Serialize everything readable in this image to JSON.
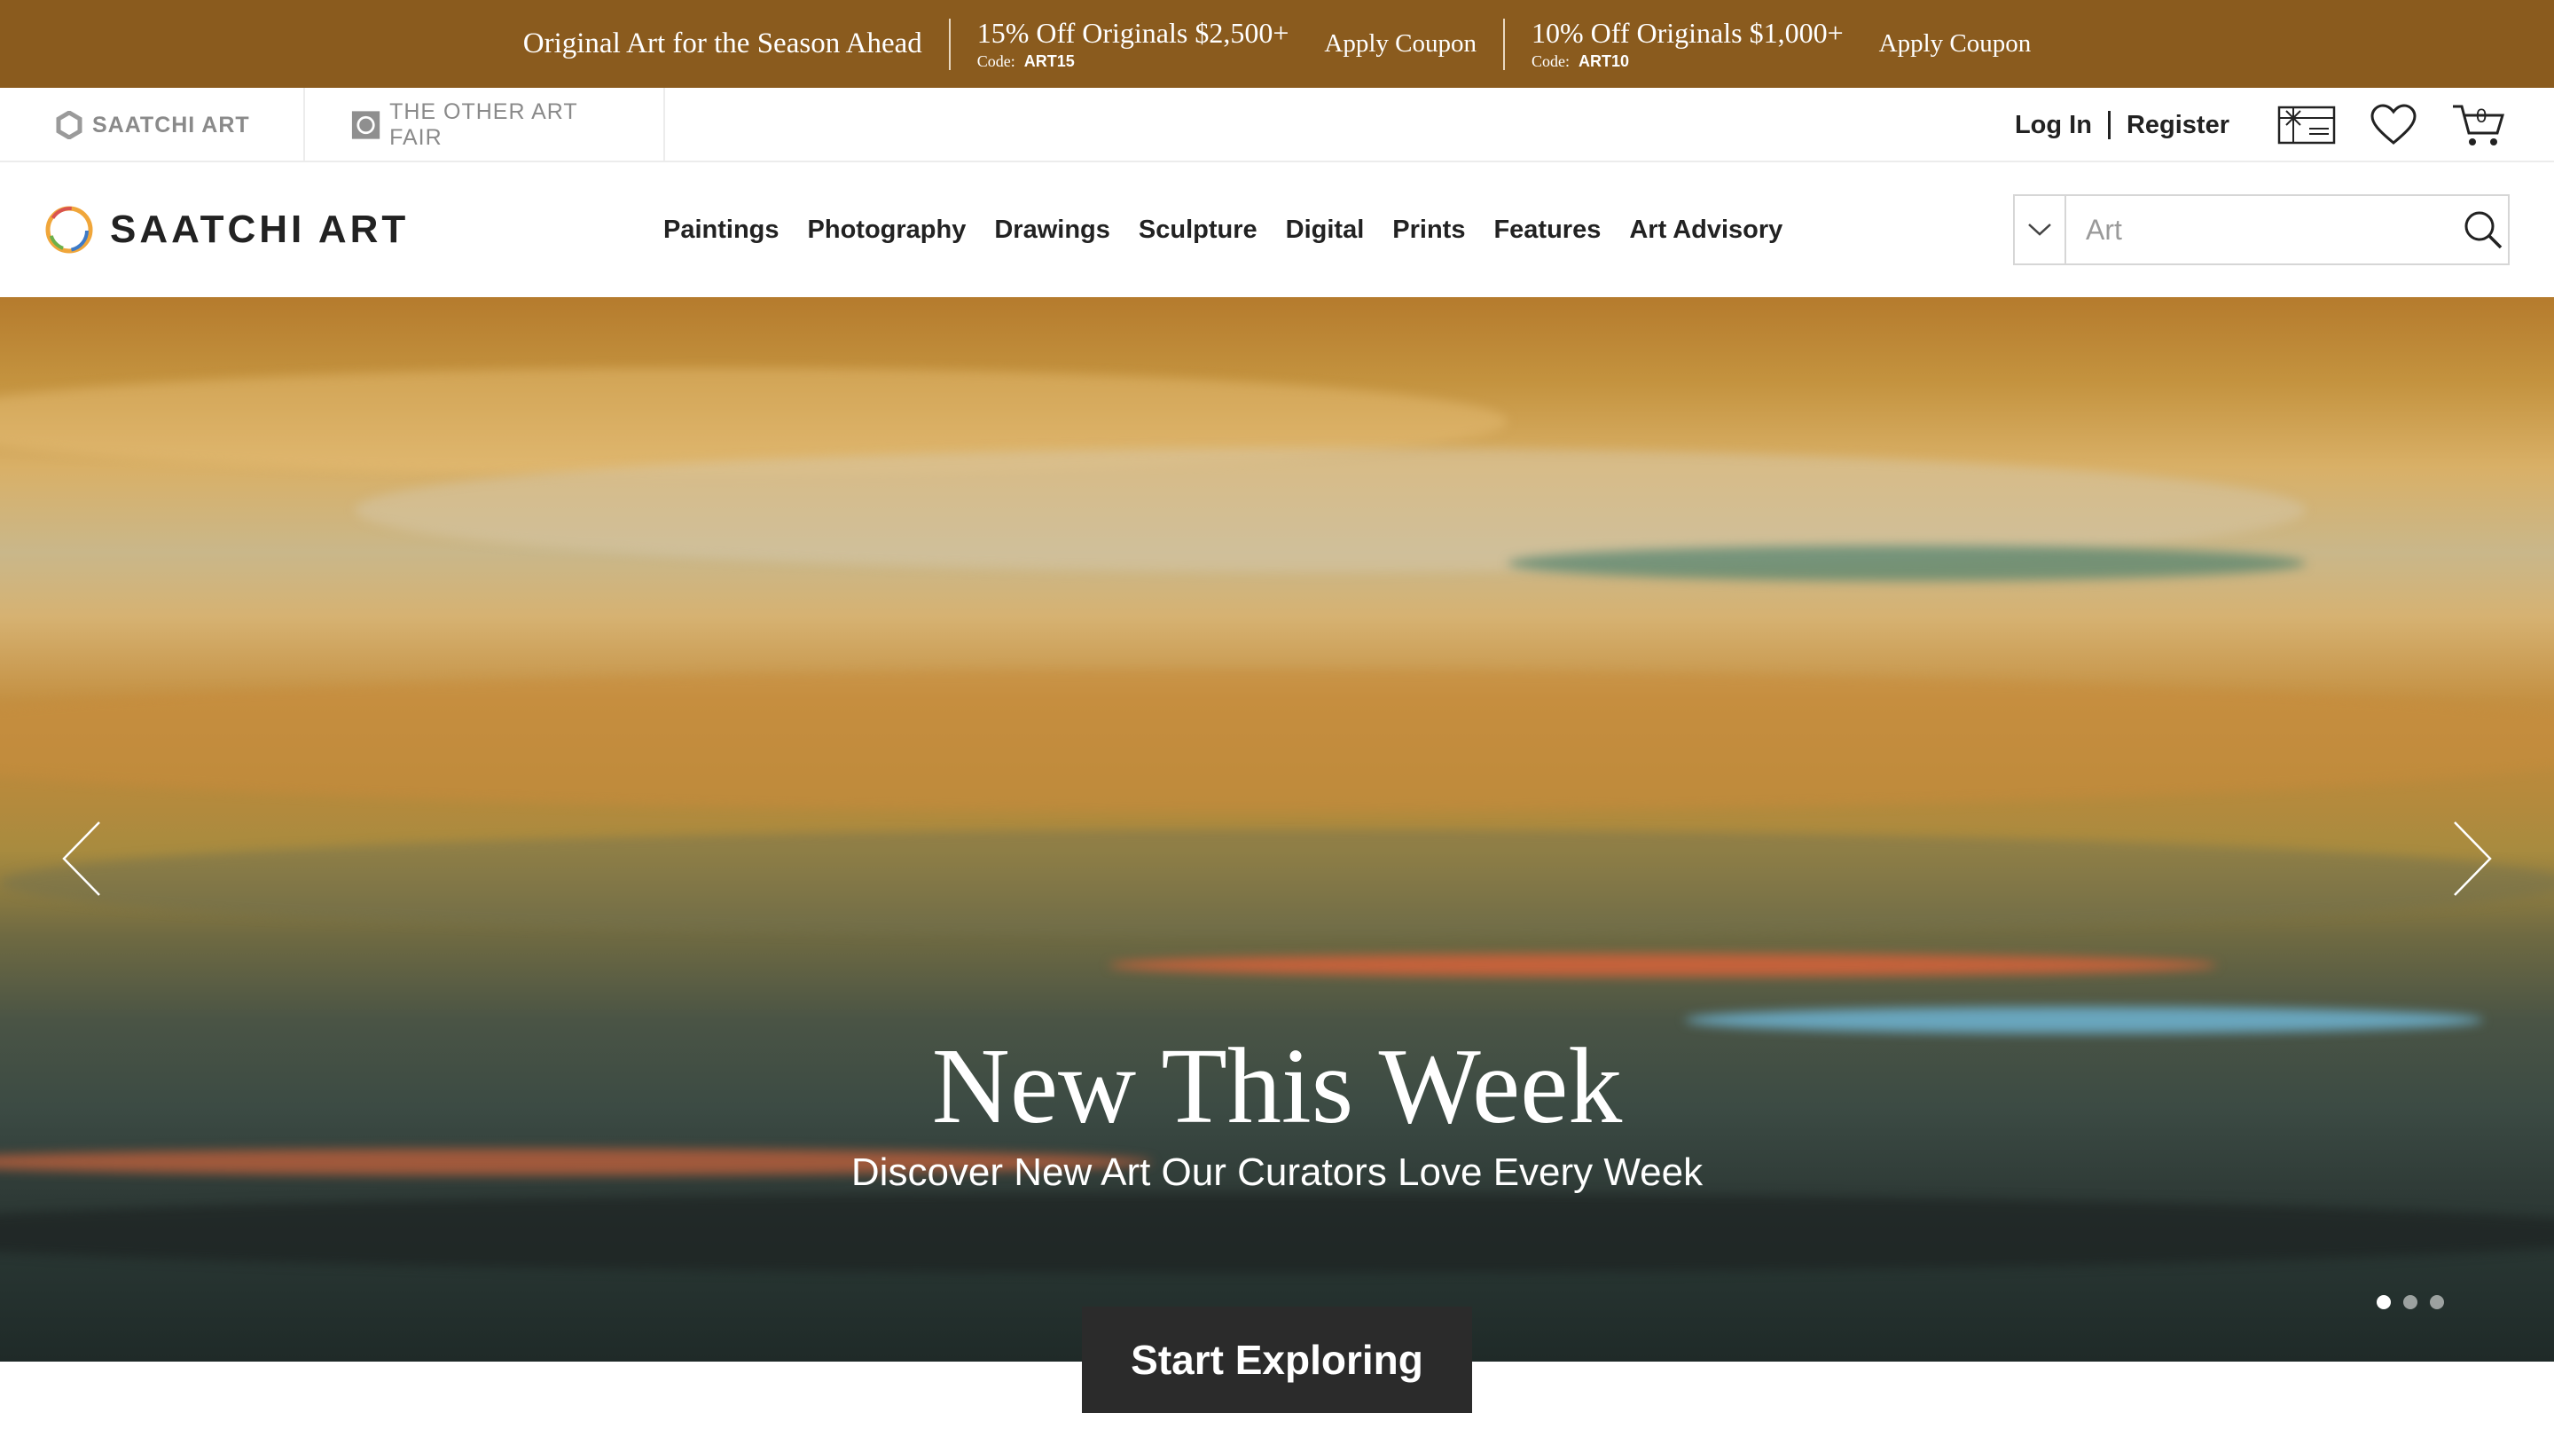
{
  "promo": {
    "headline": "Original Art for the Season Ahead",
    "offers": [
      {
        "title": "15% Off Originals $2,500+",
        "code_label": "Code:",
        "code": "ART15",
        "apply": "Apply Coupon"
      },
      {
        "title": "10% Off Originals $1,000+",
        "code_label": "Code:",
        "code": "ART10",
        "apply": "Apply Coupon"
      }
    ],
    "background": "#8a5b1e"
  },
  "utility": {
    "tabs": [
      {
        "label": "SAATCHI ART",
        "icon": "saatchi-hexagon-icon"
      },
      {
        "label": "THE OTHER ART FAIR",
        "icon": "other-art-fair-icon"
      }
    ],
    "login": "Log In",
    "register": "Register",
    "icons": [
      "gift-card-icon",
      "heart-icon",
      "cart-icon"
    ],
    "cart_count": "0"
  },
  "nav": {
    "logo": "SAATCHI ART",
    "links": [
      "Paintings",
      "Photography",
      "Drawings",
      "Sculpture",
      "Digital",
      "Prints",
      "Features",
      "Art Advisory"
    ],
    "search_placeholder": "Art"
  },
  "hero": {
    "title": "New This Week",
    "subtitle": "Discover New Art Our Curators Love Every Week",
    "cta": "Start Exploring",
    "slides": 3,
    "active_slide": 1
  }
}
